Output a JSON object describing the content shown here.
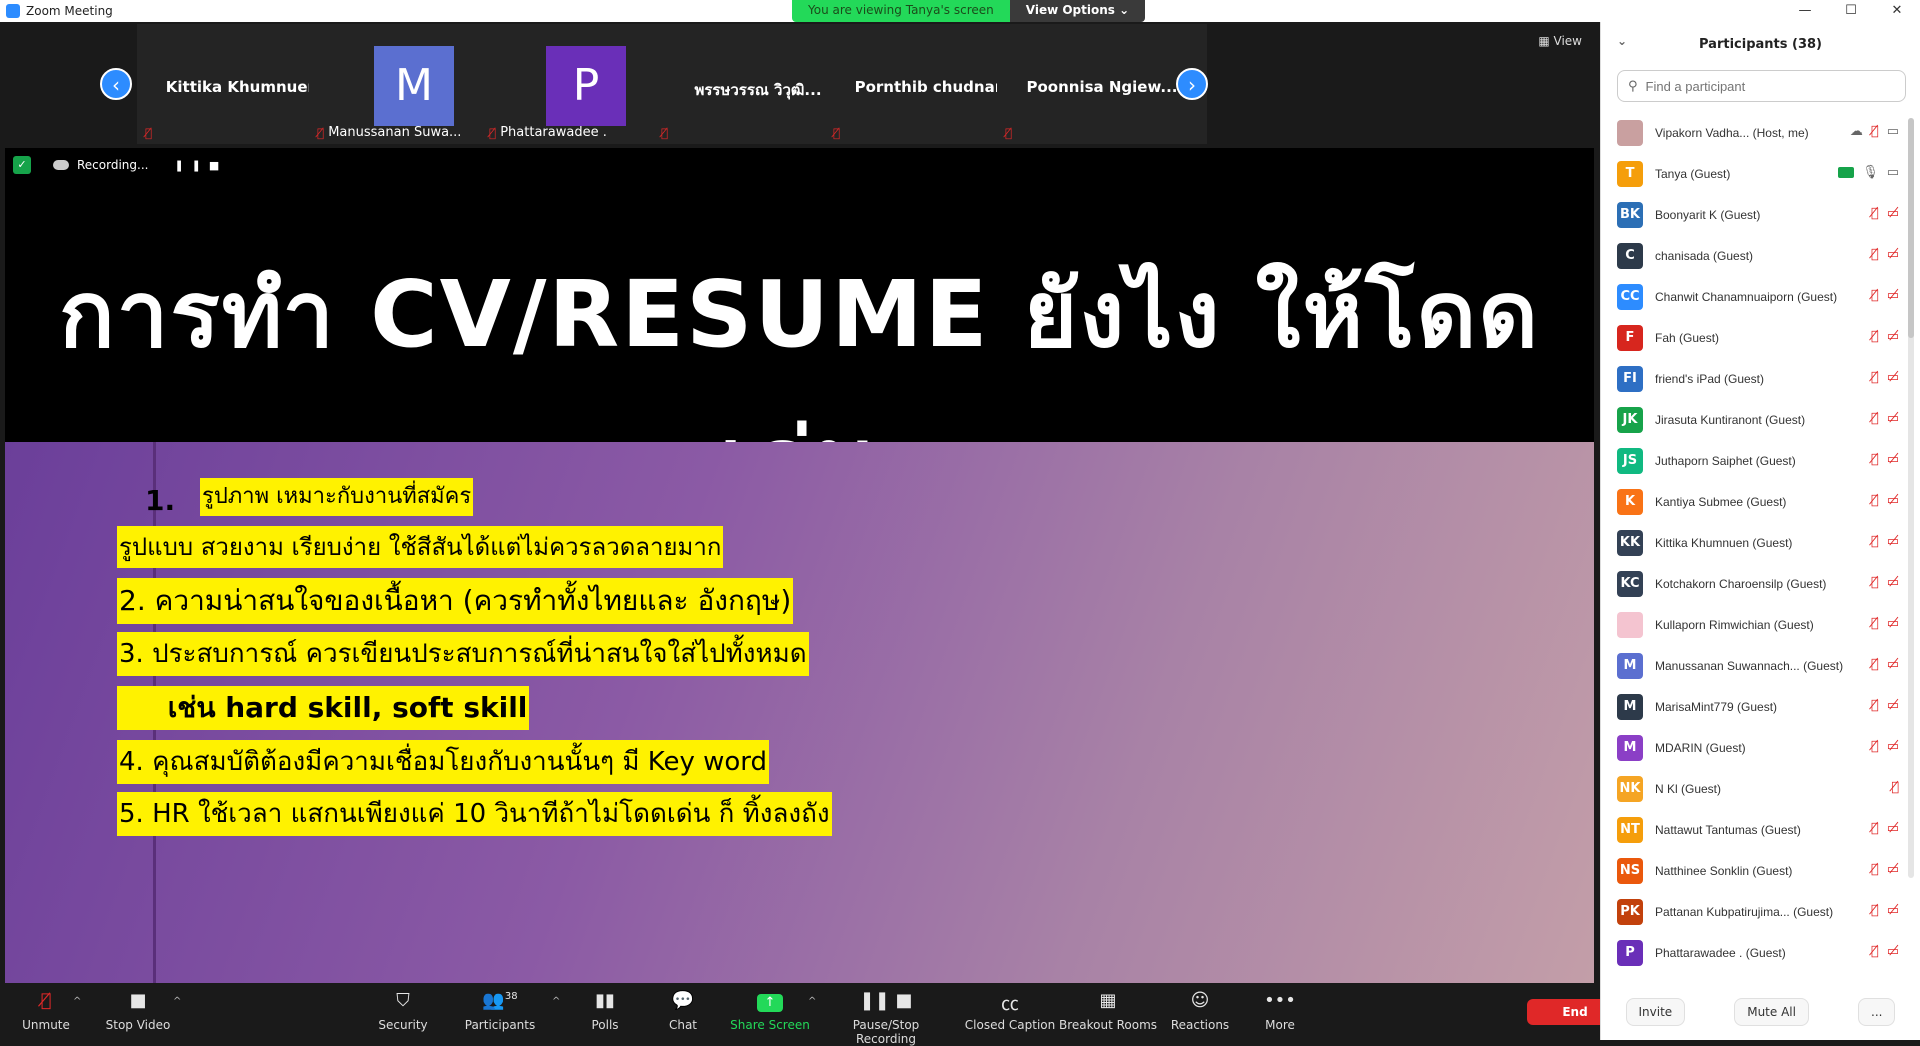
{
  "window": {
    "title": "Zoom Meeting",
    "controls": [
      "—",
      "☐",
      "✕"
    ]
  },
  "banner": {
    "viewing": "You are viewing Tanya's screen",
    "view_options": "View Options ⌄"
  },
  "strip": {
    "view_label": "View",
    "tiles": [
      {
        "name": "Kittika Khumnuen",
        "footer": ""
      },
      {
        "name": "",
        "initial": "M",
        "color": "#5b6fd0",
        "footer": "Manussanan Suwa..."
      },
      {
        "name": "",
        "initial": "P",
        "color": "#6a2fb8",
        "footer": "Phattarawadee ."
      },
      {
        "name": "พรรษวรรณ วิวุฒิ...",
        "footer": ""
      },
      {
        "name": "Pornthib chudnan",
        "footer": ""
      },
      {
        "name": "Poonnisa  Ngiew...",
        "footer": ""
      }
    ]
  },
  "share": {
    "recording": "Recording...",
    "title": "การทำ CV/RESUME ยังไง ให้โดดเด่น",
    "lines": {
      "l1_num": "1.",
      "l1": "รูปภาพ เหมาะกับงานที่สมัคร",
      "l1b": "รูปแบบ สวยงาม เรียบง่าย ใช้สีสันได้แต่ไม่ควรลวดลายมาก",
      "l2": "2. ความน่าสนใจของเนื้อหา (ควรทำทั้งไทยและ อังกฤษ)",
      "l3": "3. ประสบการณ์ ควรเขียนประสบการณ์ที่น่าสนใจใส่ไปทั้งหมด",
      "l3b": "     เช่น hard skill, soft skill",
      "l4": "4. คุณสมบัติต้องมีความเชื่อมโยงกับงานนั้นๆ มี Key word",
      "l5": "5. HR ใช้เวลา แสกนเพียงแค่ 10 วินาทีถ้าไม่โดดเด่น ก็ ทิ้งลงถัง"
    }
  },
  "toolbar": {
    "unmute": "Unmute",
    "stop_video": "Stop Video",
    "security": "Security",
    "participants": "Participants",
    "participants_count": "38",
    "polls": "Polls",
    "chat": "Chat",
    "share_screen": "Share Screen",
    "pause_rec": "Pause/Stop Recording",
    "cc": "Closed Caption",
    "breakout": "Breakout Rooms",
    "reactions": "Reactions",
    "more": "More",
    "end": "End"
  },
  "panel": {
    "title": "Participants (38)",
    "search_placeholder": "Find a participant",
    "participants": [
      {
        "initials": "",
        "name": "Vipakorn Vadha...  (Host, me)",
        "color": "#c9a0a0",
        "photo": true
      },
      {
        "initials": "T",
        "name": "Tanya (Guest)",
        "color": "#f59e0b"
      },
      {
        "initials": "BK",
        "name": "Boonyarit K (Guest)",
        "color": "#2c6fb5"
      },
      {
        "initials": "C",
        "name": "chanisada (Guest)",
        "color": "#2d3a4a"
      },
      {
        "initials": "CC",
        "name": "Chanwit Chanamnuaiporn (Guest)",
        "color": "#2d8cff"
      },
      {
        "initials": "F",
        "name": "Fah (Guest)",
        "color": "#d7261e"
      },
      {
        "initials": "FI",
        "name": "friend's iPad (Guest)",
        "color": "#2e6fc4"
      },
      {
        "initials": "JK",
        "name": "Jirasuta Kuntiranont (Guest)",
        "color": "#17a34a"
      },
      {
        "initials": "JS",
        "name": "Juthaporn Saiphet (Guest)",
        "color": "#10b981"
      },
      {
        "initials": "K",
        "name": "Kantiya Submee (Guest)",
        "color": "#f97316"
      },
      {
        "initials": "KK",
        "name": "Kittika Khumnuen (Guest)",
        "color": "#334155"
      },
      {
        "initials": "KC",
        "name": "Kotchakorn Charoensilp (Guest)",
        "color": "#334155"
      },
      {
        "initials": "",
        "name": "Kullaporn Rimwichian (Guest)",
        "color": "#f4c4d0",
        "photo": true
      },
      {
        "initials": "M",
        "name": "Manussanan Suwannach... (Guest)",
        "color": "#5b6fd0"
      },
      {
        "initials": "M",
        "name": "MarisaMint779 (Guest)",
        "color": "#2d3a4a"
      },
      {
        "initials": "M",
        "name": "MDARIN (Guest)",
        "color": "#8b3fc6"
      },
      {
        "initials": "NK",
        "name": "N Kl (Guest)",
        "color": "#f5a524"
      },
      {
        "initials": "NT",
        "name": "Nattawut Tantumas (Guest)",
        "color": "#f59e0b"
      },
      {
        "initials": "NS",
        "name": "Natthinee Sonklin (Guest)",
        "color": "#ea580c"
      },
      {
        "initials": "PK",
        "name": "Pattanan Kubpatirujima...  (Guest)",
        "color": "#c2410c"
      },
      {
        "initials": "P",
        "name": "Phattarawadee . (Guest)",
        "color": "#6a2fb8"
      }
    ],
    "invite": "Invite",
    "mute_all": "Mute All",
    "more": "..."
  }
}
